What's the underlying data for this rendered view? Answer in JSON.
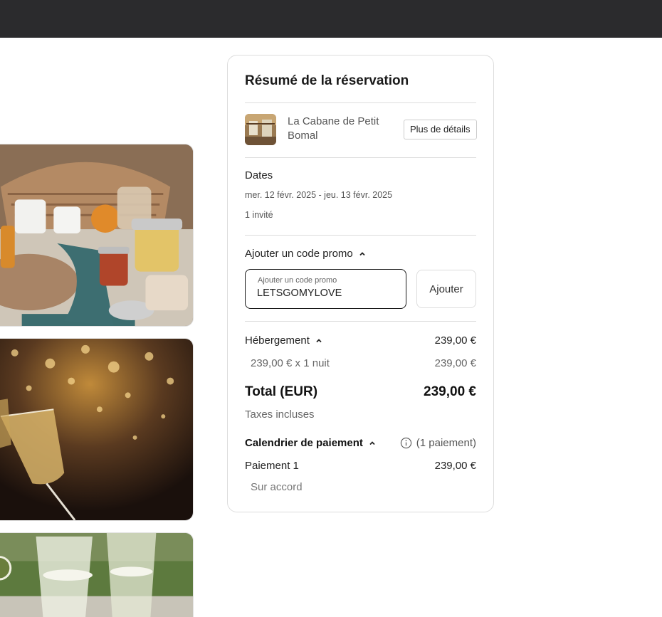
{
  "summary": {
    "title": "Résumé de la réservation",
    "property_name": "La Cabane de Petit Bomal",
    "details_button": "Plus de détails",
    "dates_label": "Dates",
    "dates_value": "mer. 12 févr. 2025 - jeu. 13 févr. 2025",
    "guests": "1 invité",
    "promo_toggle": "Ajouter un code promo",
    "promo_field_label": "Ajouter un code promo",
    "promo_value": "LETSGOMYLOVE",
    "add_button": "Ajouter",
    "lodging_label": "Hébergement",
    "lodging_amount": "239,00 €",
    "lodging_detail": "239,00 € x 1 nuit",
    "lodging_detail_amount": "239,00 €",
    "total_label": "Total (EUR)",
    "total_amount": "239,00 €",
    "taxes": "Taxes incluses",
    "schedule_label": "Calendrier de paiement",
    "schedule_count": "(1 paiement)",
    "payment1_label": "Paiement 1",
    "payment1_amount": "239,00 €",
    "payment1_when": "Sur accord"
  },
  "icons": {
    "chevron": "chevron-up-icon",
    "info": "info-icon"
  },
  "colors": {
    "topbar": "#2b2b2d",
    "border": "#dddddd",
    "text": "#222222"
  }
}
